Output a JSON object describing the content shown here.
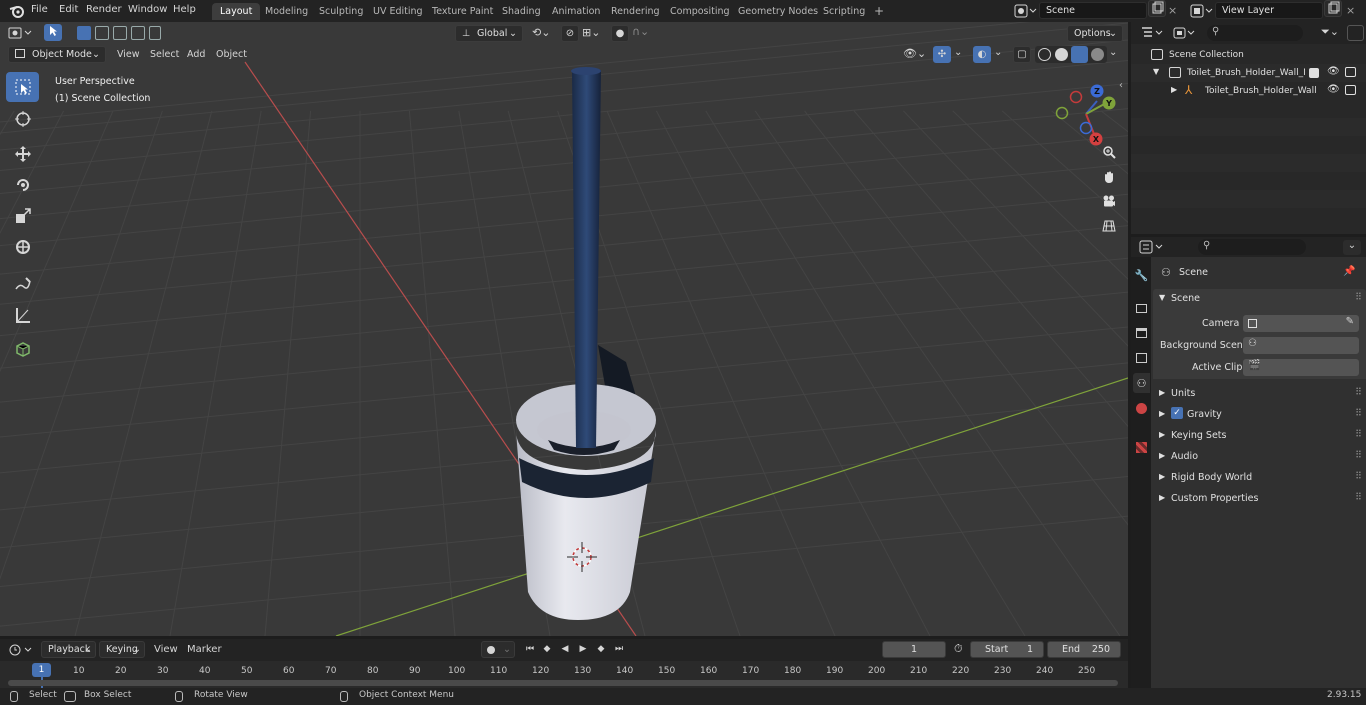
{
  "topbar": {
    "menus": [
      "File",
      "Edit",
      "Render",
      "Window",
      "Help"
    ],
    "workspaces": [
      "Layout",
      "Modeling",
      "Sculpting",
      "UV Editing",
      "Texture Paint",
      "Shading",
      "Animation",
      "Rendering",
      "Compositing",
      "Geometry Nodes",
      "Scripting"
    ],
    "active_workspace": "Layout",
    "add_workspace": "+",
    "scene_name": "Scene",
    "view_layer": "View Layer"
  },
  "viewport": {
    "mode": "Object Mode",
    "menus": [
      "View",
      "Select",
      "Add",
      "Object"
    ],
    "transform_orientation": "Global",
    "options_label": "Options",
    "overlay_line1": "User Perspective",
    "overlay_line2": "(1) Scene Collection",
    "gizmo_axes": [
      "X",
      "Y",
      "Z"
    ],
    "tools": [
      "select-box-icon",
      "cursor-icon",
      "move-icon",
      "rotate-icon",
      "scale-icon",
      "transform-icon",
      "annotate-icon",
      "measure-icon",
      "add-cube-icon"
    ],
    "nav_buttons": [
      "zoom-icon",
      "hand-pan-icon",
      "camera-icon",
      "grid-ortho-icon"
    ],
    "colors": {
      "x_axis": "#b84d4d",
      "y_axis": "#7fa33a",
      "accent": "#4772b3",
      "cup": "#dcdde4",
      "band": "#1b2433",
      "handle": "#253b62"
    }
  },
  "outliner": {
    "root": "Scene Collection",
    "items": [
      {
        "label": "Toilet_Brush_Holder_Wall_Mo",
        "indent": 1,
        "icon": "collection-icon"
      },
      {
        "label": "Toilet_Brush_Holder_Wall",
        "indent": 2,
        "icon": "armature-empty-icon"
      }
    ]
  },
  "properties": {
    "header_title": "Scene",
    "section_title": "Scene",
    "fields": [
      {
        "label": "Camera",
        "value": ""
      },
      {
        "label": "Background Scene",
        "value": ""
      },
      {
        "label": "Active Clip",
        "value": ""
      }
    ],
    "sections": [
      "Units",
      "Gravity",
      "Keying Sets",
      "Audio",
      "Rigid Body World",
      "Custom Properties"
    ],
    "gravity_checked": true
  },
  "timeline": {
    "menus": [
      "Playback",
      "Keying",
      "View",
      "Marker"
    ],
    "current_frame": "1",
    "start_label": "Start",
    "start_value": "1",
    "end_label": "End",
    "end_value": "250",
    "frame_marker": "1",
    "ticks": [
      "10",
      "20",
      "30",
      "40",
      "50",
      "60",
      "70",
      "80",
      "90",
      "100",
      "110",
      "120",
      "130",
      "140",
      "150",
      "160",
      "170",
      "180",
      "190",
      "200",
      "210",
      "220",
      "230",
      "240",
      "250"
    ]
  },
  "statusbar": {
    "select": "Select",
    "box_select": "Box Select",
    "rotate_view": "Rotate View",
    "context_menu": "Object Context Menu",
    "version": "2.93.15"
  }
}
